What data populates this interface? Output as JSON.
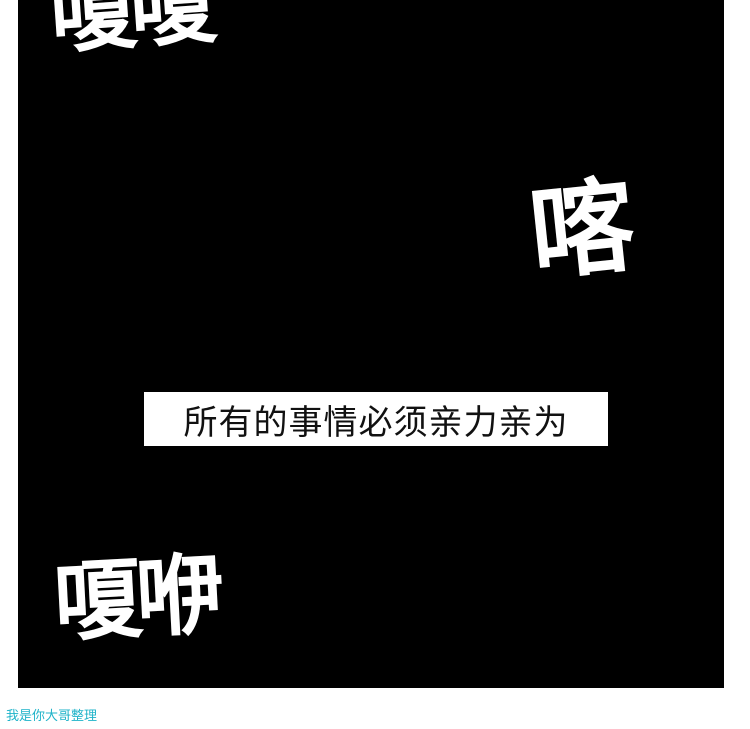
{
  "panel": {
    "sfx_top": "嗄嗄",
    "sfx_mid": "喀",
    "sfx_bottom": "嗄咿",
    "caption": "所有的事情必须亲力亲为"
  },
  "watermark": "我是你大哥整理",
  "colors": {
    "panel_bg": "#000000",
    "page_bg": "#ffffff",
    "sfx": "#ffffff",
    "watermark": "#1fb3c9"
  }
}
